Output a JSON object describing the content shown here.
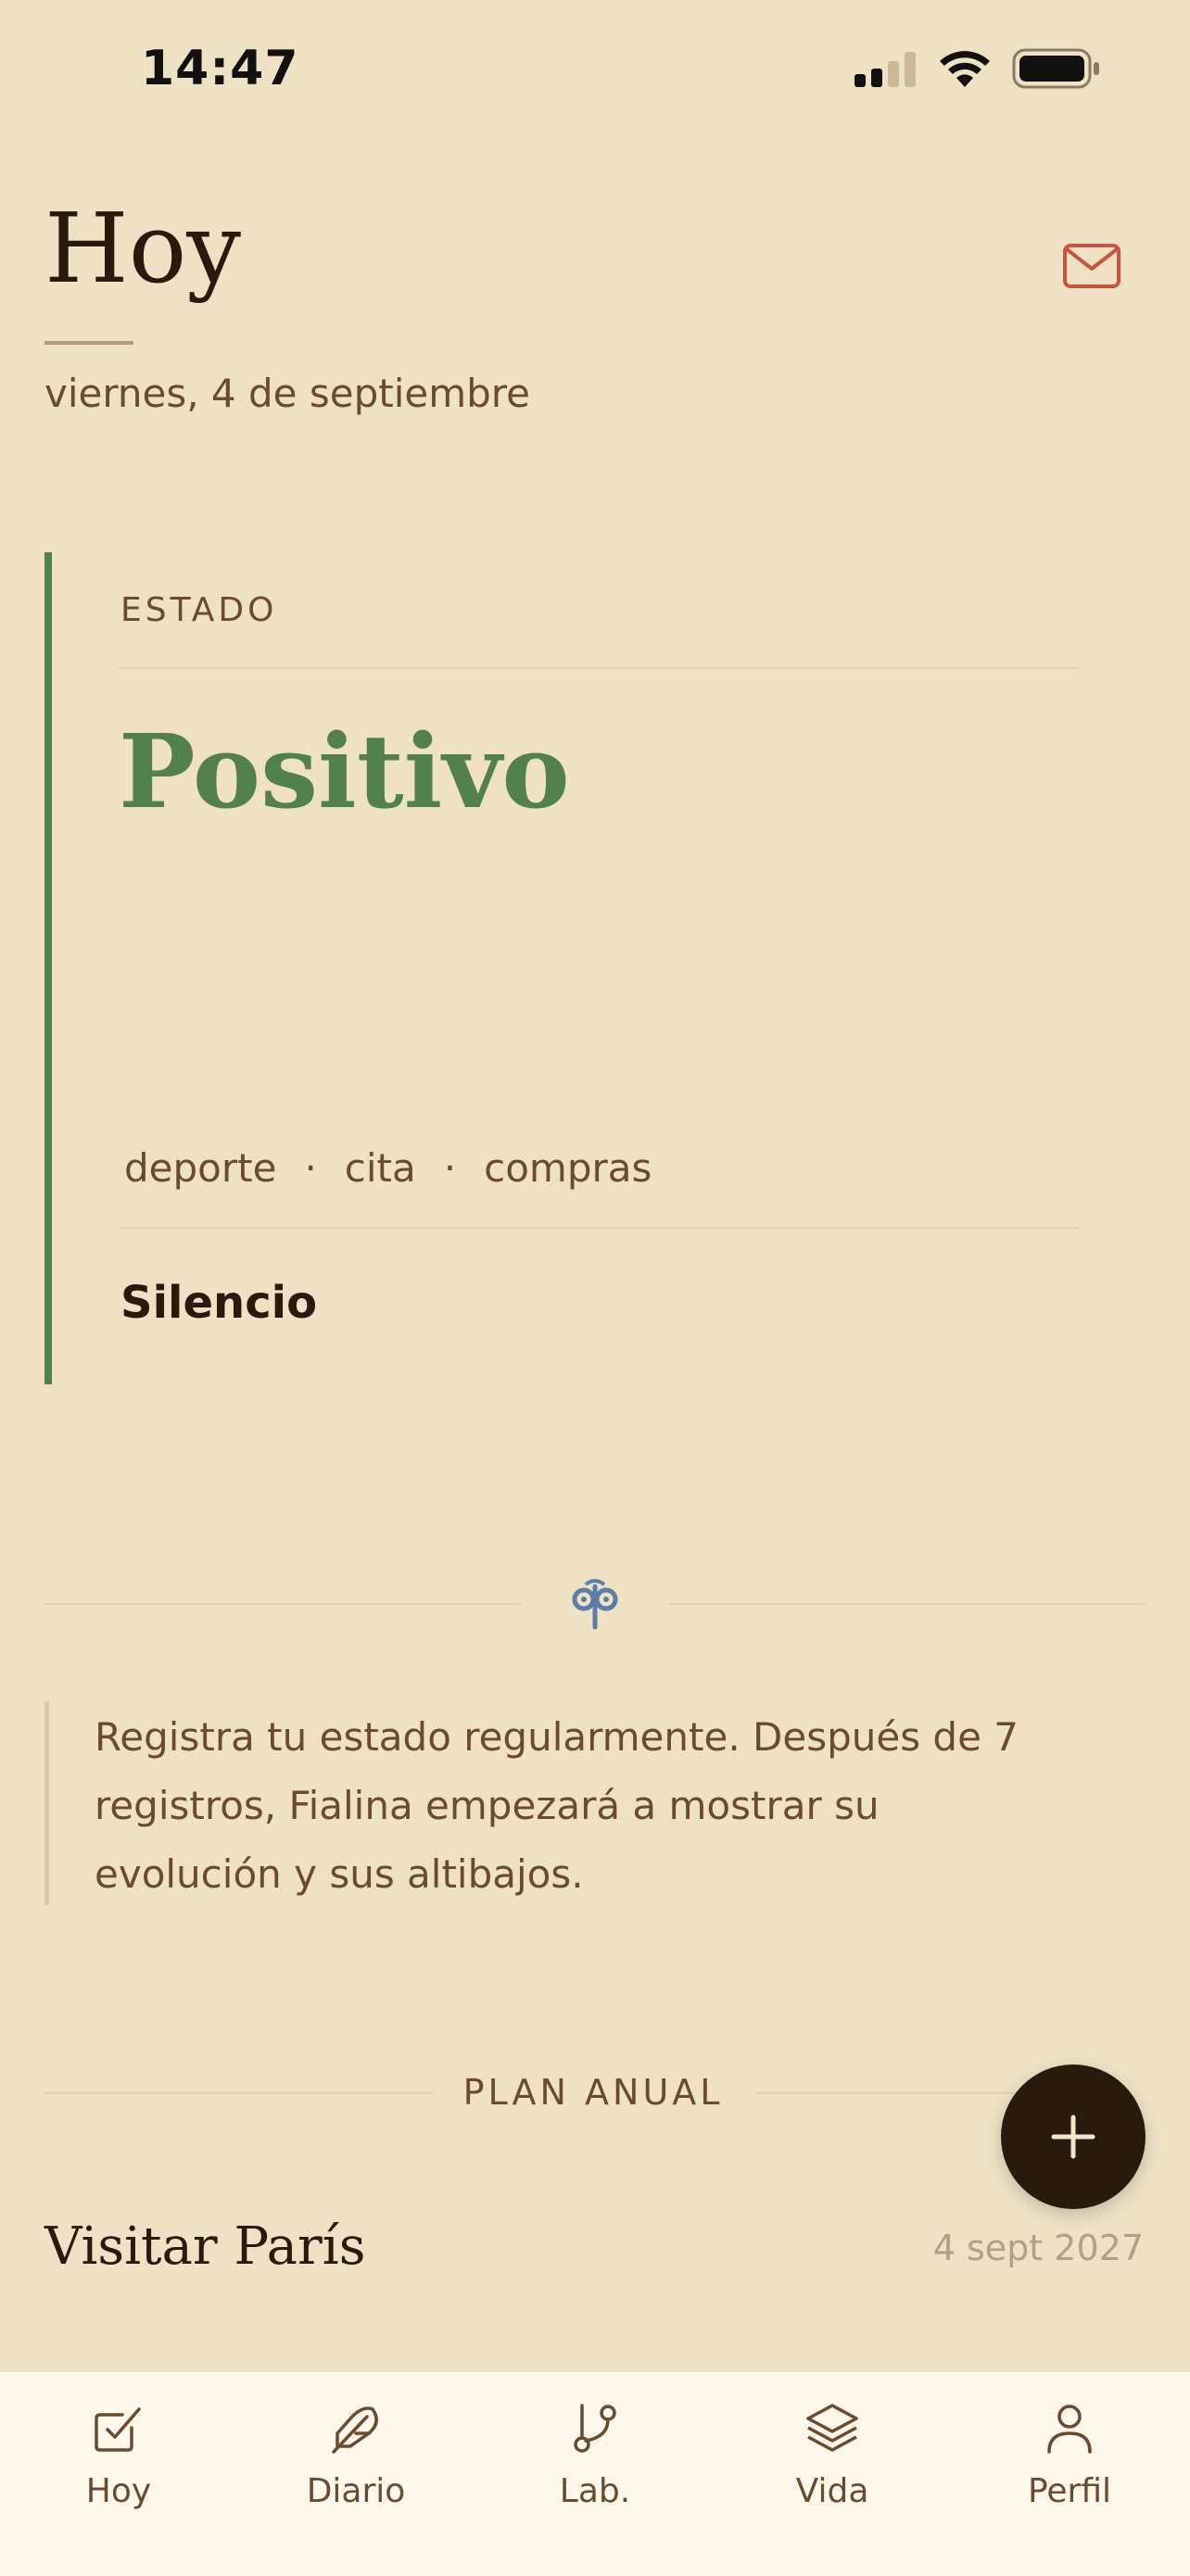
{
  "status_bar": {
    "time": "14:47"
  },
  "header": {
    "title": "Hoy",
    "date": "viernes, 4 de septiembre"
  },
  "estado_card": {
    "label": "ESTADO",
    "value": "Positivo",
    "tags": [
      "deporte",
      "cita",
      "compras"
    ],
    "tag_separator": "·",
    "note": "Silencio"
  },
  "quote": {
    "text": "Registra tu estado regularmente. Después de 7 registros, Fialina empezará a mostrar su evolución y sus altibajos."
  },
  "plan": {
    "label": "PLAN ANUAL",
    "items": [
      {
        "title": "Visitar París",
        "date": "4 sept 2027"
      }
    ]
  },
  "tabbar": {
    "items": [
      {
        "label": "Hoy",
        "icon": "checkbox-icon"
      },
      {
        "label": "Diario",
        "icon": "feather-icon"
      },
      {
        "label": "Lab.",
        "icon": "branch-icon"
      },
      {
        "label": "Vida",
        "icon": "layers-icon"
      },
      {
        "label": "Perfil",
        "icon": "user-icon"
      }
    ]
  },
  "colors": {
    "background": "#efe2c4",
    "accent_green": "#52804f",
    "text_dark": "#2a1a0e",
    "text_brown": "#6b4a2e",
    "mail_red": "#c9533c",
    "ornament_blue": "#5b7ea8"
  }
}
